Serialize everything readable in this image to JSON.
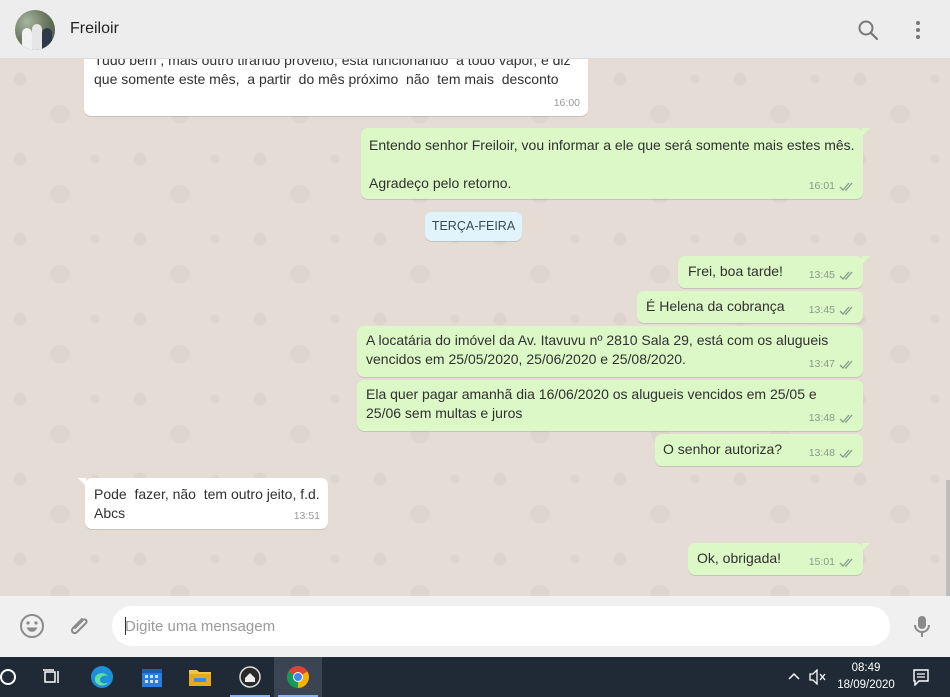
{
  "header": {
    "contact_name": "Freiloir",
    "icons": [
      "search-icon",
      "kebab-menu-icon"
    ]
  },
  "messages": [
    {
      "dir": "in",
      "text": "Tudo bem , mais outro tirando proveito, esta funcionando  a todo vapor, e diz que somente este mês,  a partir  do mês próximo  não  tem mais  desconto",
      "time": "16:00"
    },
    {
      "dir": "out",
      "text": "Entendo senhor Freiloir, vou informar a ele que será somente mais estes mês.\n\nAgradeço pelo retorno.",
      "time": "16:01"
    },
    {
      "dir": "out",
      "text": "Frei, boa tarde!",
      "time": "13:45"
    },
    {
      "dir": "out",
      "text": "É Helena da cobrança",
      "time": "13:45"
    },
    {
      "dir": "out",
      "text": "A locatária do imóvel da Av. Itavuvu nº 2810 Sala 29, está com os alugueis vencidos em 25/05/2020, 25/06/2020 e 25/08/2020.",
      "time": "13:47"
    },
    {
      "dir": "out",
      "text": "Ela quer pagar amanhã dia 16/06/2020 os alugueis vencidos em 25/05 e 25/06 sem multas e juros",
      "time": "13:48"
    },
    {
      "dir": "out",
      "text": "O senhor autoriza?",
      "time": "13:48"
    },
    {
      "dir": "in",
      "text": "Pode  fazer, não  tem outro jeito, f.d.\nAbcs",
      "time": "13:51"
    },
    {
      "dir": "out",
      "text": "Ok, obrigada!",
      "time": "15:01"
    }
  ],
  "day_separator": "TERÇA-FEIRA",
  "composer": {
    "placeholder": "Digite uma mensagem",
    "icons": [
      "emoji-icon",
      "attach-icon",
      "microphone-icon"
    ]
  },
  "taskbar": {
    "time": "08:49",
    "date": "18/09/2020",
    "apps": [
      "cortana-icon",
      "task-view-icon",
      "edge-icon",
      "calendar-icon",
      "file-explorer-icon",
      "app-icon",
      "chrome-icon"
    ]
  },
  "colors": {
    "outgoing_bubble": "#dcf8c6",
    "incoming_bubble": "#ffffff",
    "chat_background": "#e5ddd5",
    "read_tick": "#4fc3f7"
  }
}
